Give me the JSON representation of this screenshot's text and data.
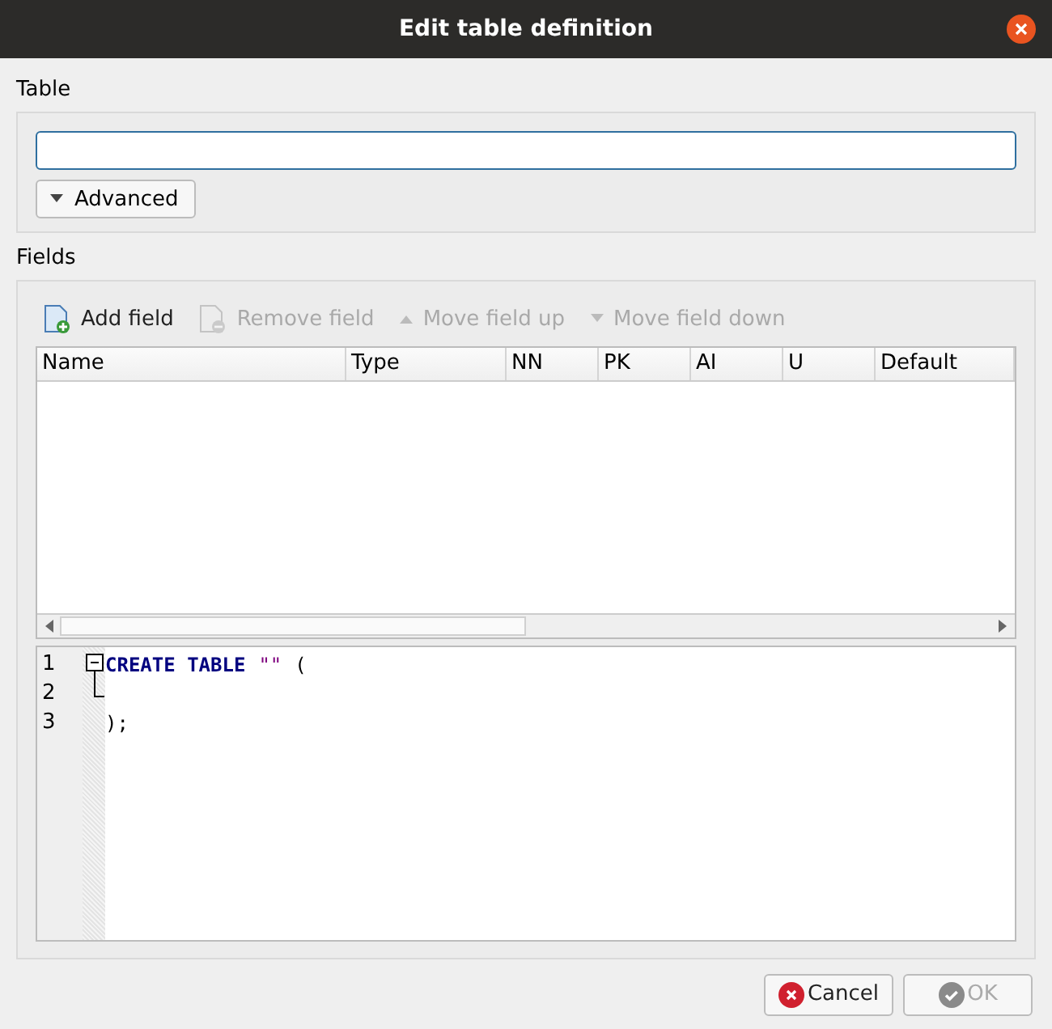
{
  "window": {
    "title": "Edit table definition"
  },
  "table_section": {
    "label": "Table",
    "name_field": {
      "focused": true
    },
    "advanced_button": {
      "label": "Advanced",
      "expanded": false
    }
  },
  "fields_section": {
    "label": "Fields",
    "toolbar": [
      {
        "kind": "add",
        "label": "Add field",
        "disabled": false
      },
      {
        "kind": "remove",
        "label": "Remove field",
        "disabled": true
      },
      {
        "kind": "up",
        "label": "Move field up",
        "disabled": true
      },
      {
        "kind": "down",
        "label": "Move field down",
        "disabled": true
      }
    ],
    "table": {
      "columns": [
        "Name",
        "Type",
        "NN",
        "PK",
        "AI",
        "U",
        "Default"
      ]
    }
  },
  "sql_editor": {
    "fold_expanded": true,
    "lines": [
      {
        "number": "1",
        "tokens": [
          {
            "kind": "keyword",
            "text": "CREATE TABLE"
          },
          {
            "kind": "string",
            "text": "\"\""
          },
          {
            "kind": "plain",
            "text": "("
          }
        ]
      },
      {
        "number": "2"
      },
      {
        "number": "3",
        "tokens": [
          {
            "kind": "plain",
            "text": ");"
          }
        ]
      }
    ]
  },
  "buttons": [
    {
      "kind": "cancel",
      "label": "Cancel",
      "disabled": false
    },
    {
      "kind": "ok",
      "label": "OK",
      "disabled": true
    }
  ]
}
